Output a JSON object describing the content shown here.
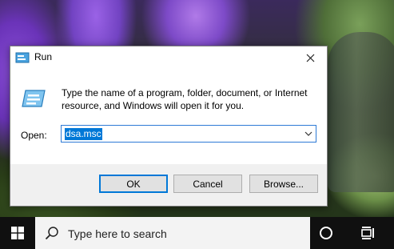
{
  "dialog": {
    "title": "Run",
    "description": "Type the name of a program, folder, document, or Internet resource, and Windows will open it for you.",
    "open_label": "Open:",
    "open_value": "dsa.msc",
    "buttons": {
      "ok": "OK",
      "cancel": "Cancel",
      "browse": "Browse..."
    }
  },
  "taskbar": {
    "search_placeholder": "Type here to search"
  },
  "colors": {
    "accent": "#0078d7",
    "taskbar_bg": "#101010",
    "dialog_bg": "#f0f0f0"
  },
  "icons": [
    "run-app-icon",
    "close-icon",
    "run-program-icon",
    "chevron-down-icon",
    "windows-start-icon",
    "search-icon",
    "cortana-icon",
    "task-view-icon"
  ]
}
